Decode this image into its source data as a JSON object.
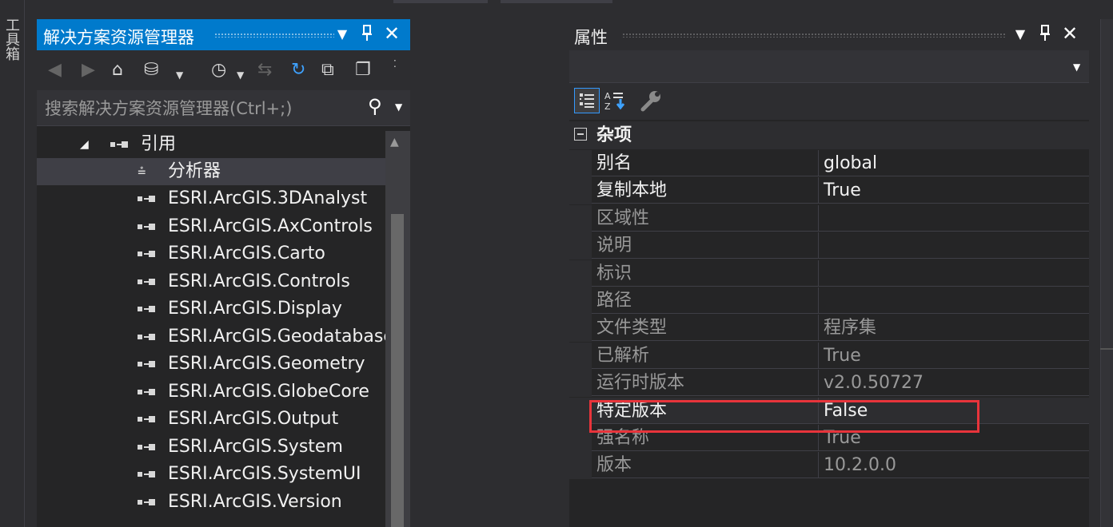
{
  "toolbox": {
    "label": "工具箱"
  },
  "solution_explorer": {
    "title": "解决方案资源管理器",
    "search_placeholder": "搜索解决方案资源管理器(Ctrl+;)",
    "toolbar_icons": [
      "back-icon",
      "forward-icon",
      "home-icon",
      "switch-views-icon",
      "dropdown-icon",
      "pending-changes-icon",
      "dropdown-icon",
      "sync-icon",
      "refresh-icon",
      "collapse-all-icon",
      "show-all-files-icon"
    ],
    "tree": {
      "references_label": "引用",
      "analyzers_label": "分析器",
      "items": [
        "ESRI.ArcGIS.3DAnalyst",
        "ESRI.ArcGIS.AxControls",
        "ESRI.ArcGIS.Carto",
        "ESRI.ArcGIS.Controls",
        "ESRI.ArcGIS.Display",
        "ESRI.ArcGIS.Geodatabase",
        "ESRI.ArcGIS.Geometry",
        "ESRI.ArcGIS.GlobeCore",
        "ESRI.ArcGIS.Output",
        "ESRI.ArcGIS.System",
        "ESRI.ArcGIS.SystemUI",
        "ESRI.ArcGIS.Version"
      ]
    }
  },
  "properties": {
    "title": "属性",
    "category": "杂项",
    "rows": [
      {
        "name": "别名",
        "value": "global",
        "readonly": false
      },
      {
        "name": "复制本地",
        "value": "True",
        "readonly": false
      },
      {
        "name": "区域性",
        "value": "",
        "readonly": true
      },
      {
        "name": "说明",
        "value": "",
        "readonly": true
      },
      {
        "name": "标识",
        "value": "",
        "readonly": true
      },
      {
        "name": "路径",
        "value": "",
        "readonly": true
      },
      {
        "name": "文件类型",
        "value": "程序集",
        "readonly": true
      },
      {
        "name": "已解析",
        "value": "True",
        "readonly": true
      },
      {
        "name": "运行时版本",
        "value": "v2.0.50727",
        "readonly": true
      },
      {
        "name": "特定版本",
        "value": "False",
        "readonly": false
      },
      {
        "name": "强名称",
        "value": "True",
        "readonly": true
      },
      {
        "name": "版本",
        "value": "10.2.0.0",
        "readonly": true
      }
    ],
    "highlight_color": "#e8343b"
  },
  "colors": {
    "accent": "#007acc",
    "background": "#2d2d30",
    "panel": "#252526"
  }
}
